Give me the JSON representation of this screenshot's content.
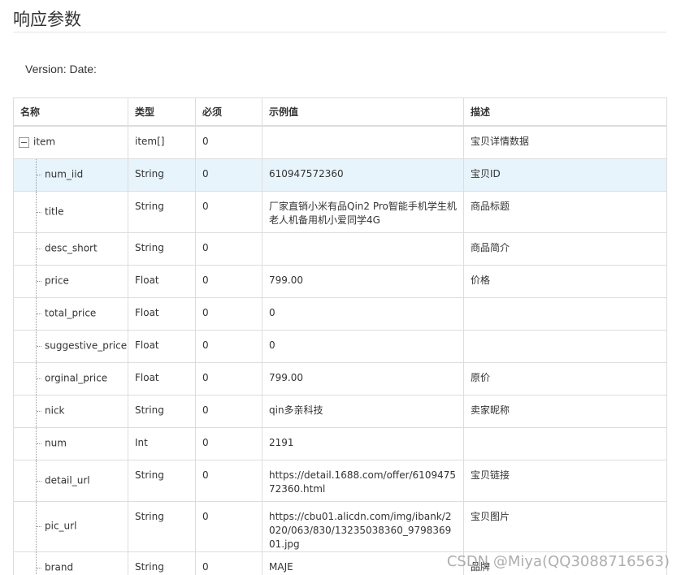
{
  "section": {
    "title": "响应参数"
  },
  "version_line": "Version: Date:",
  "table": {
    "headers": [
      "名称",
      "类型",
      "必须",
      "示例值",
      "描述"
    ],
    "root": {
      "name": "item",
      "type": "item[]",
      "required": "0",
      "example": "",
      "desc": "宝贝详情数据"
    },
    "rows": [
      {
        "name": "num_iid",
        "type": "String",
        "required": "0",
        "example": "610947572360",
        "desc": "宝贝ID"
      },
      {
        "name": "title",
        "type": "String",
        "required": "0",
        "example": "厂家直销小米有品Qin2 Pro智能手机学生机老人机备用机小爱同学4G",
        "desc": "商品标题"
      },
      {
        "name": "desc_short",
        "type": "String",
        "required": "0",
        "example": "",
        "desc": "商品简介"
      },
      {
        "name": "price",
        "type": "Float",
        "required": "0",
        "example": "799.00",
        "desc": "价格"
      },
      {
        "name": "total_price",
        "type": "Float",
        "required": "0",
        "example": "0",
        "desc": ""
      },
      {
        "name": "suggestive_price",
        "type": "Float",
        "required": "0",
        "example": "0",
        "desc": ""
      },
      {
        "name": "orginal_price",
        "type": "Float",
        "required": "0",
        "example": "799.00",
        "desc": "原价"
      },
      {
        "name": "nick",
        "type": "String",
        "required": "0",
        "example": "qin多亲科技",
        "desc": "卖家昵称"
      },
      {
        "name": "num",
        "type": "Int",
        "required": "0",
        "example": "2191",
        "desc": ""
      },
      {
        "name": "detail_url",
        "type": "String",
        "required": "0",
        "example": "https://detail.1688.com/offer/610947572360.html",
        "desc": "宝贝链接"
      },
      {
        "name": "pic_url",
        "type": "String",
        "required": "0",
        "example": "https://cbu01.alicdn.com/img/ibank/2020/063/830/13235038360_979836901.jpg",
        "desc": "宝贝图片"
      },
      {
        "name": "brand",
        "type": "String",
        "required": "0",
        "example": "MAJE",
        "desc": "品牌"
      }
    ]
  },
  "watermark": "CSDN @Miya(QQ3088716563)",
  "colors": {
    "row_highlight": "#e8f4fc",
    "border": "#dddddd",
    "text": "#333333"
  },
  "icons": {
    "toggle": "collapse-minus-icon"
  }
}
